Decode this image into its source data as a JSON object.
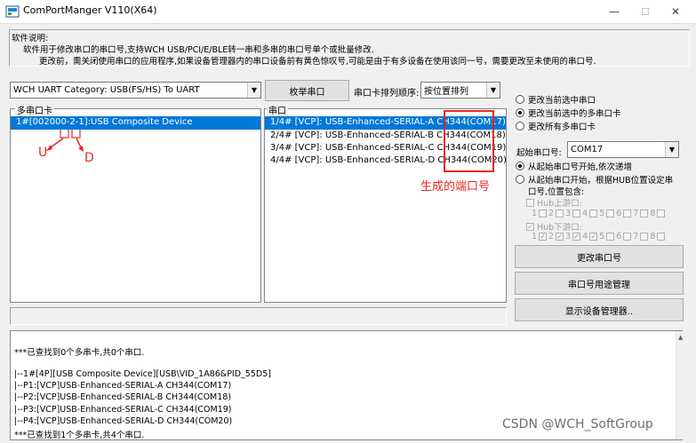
{
  "window": {
    "title": "ComPortManger V110(X64)",
    "minimize": "—",
    "maximize": "☐",
    "close": "✕"
  },
  "description": {
    "label": "软件说明:",
    "line1": "软件用于修改串口的串口号,支持WCH USB/PCI/E/BLE转一串和多串的串口号单个或批量修改.",
    "line2": "更改前，需关闭使用串口的应用程序,如果设备管理器内的串口设备前有黄色惊叹号,可能是由于有多设备在使用该同一号，需要更改至未使用的串口号."
  },
  "category": {
    "selected": "WCH UART Category:  USB(FS/HS) To UART"
  },
  "enum_button": "枚举串口",
  "sort": {
    "label": "串口卡排列顺序:",
    "selected": "按位置排列"
  },
  "multi_card": {
    "label": "多串口卡",
    "items": [
      "1#[002000-2-1]:USB Composite Device"
    ]
  },
  "ports": {
    "label": "串口",
    "items": [
      "1/4# [VCP]: USB-Enhanced-SERIAL-A CH344(COM17)",
      "2/4# [VCP]: USB-Enhanced-SERIAL-B CH344(COM18)",
      "3/4# [VCP]: USB-Enhanced-SERIAL-C CH344(COM19)",
      "4/4# [VCP]: USB-Enhanced-SERIAL-D CH344(COM20)"
    ]
  },
  "annotations": {
    "u": "U",
    "d": "D",
    "generated_port": "生成的端口号",
    "accent_color": "#e8281e"
  },
  "options": {
    "radio1": "更改当前选中串口",
    "radio2": "更改当前选中的多串口卡",
    "radio3": "更改所有多串口卡",
    "start_label": "起始串口号:",
    "start_value": "COM17",
    "mode1": "从起始串口号开始,依次递增",
    "mode2a": "从起始串口开始，根据HUB位置设定串",
    "mode2b": "口号,位置包含:",
    "hub_up": "Hub上游口:",
    "hub_down": "Hub下游口:",
    "digits": [
      "1",
      "2",
      "3",
      "4",
      "5",
      "6",
      "7",
      "8"
    ]
  },
  "buttons": {
    "change": "更改串口号",
    "usage": "串口号用途管理",
    "devmgr": "显示设备管理器.."
  },
  "log": {
    "lines": [
      "***已查找到0个多串卡,共0个串口.",
      "",
      "|--1#[4P][USB Composite Device][USB\\VID_1A86&PID_55D5]",
      "   |--P1:[VCP]USB-Enhanced-SERIAL-A CH344(COM17)",
      "   |--P2:[VCP]USB-Enhanced-SERIAL-B CH344(COM18)",
      "   |--P3:[VCP]USB-Enhanced-SERIAL-C CH344(COM19)",
      "   |--P4:[VCP]USB-Enhanced-SERIAL-D CH344(COM20)",
      "***已查找到1个多串卡,共4个串口."
    ]
  },
  "watermark": "CSDN @WCH_SoftGroup"
}
